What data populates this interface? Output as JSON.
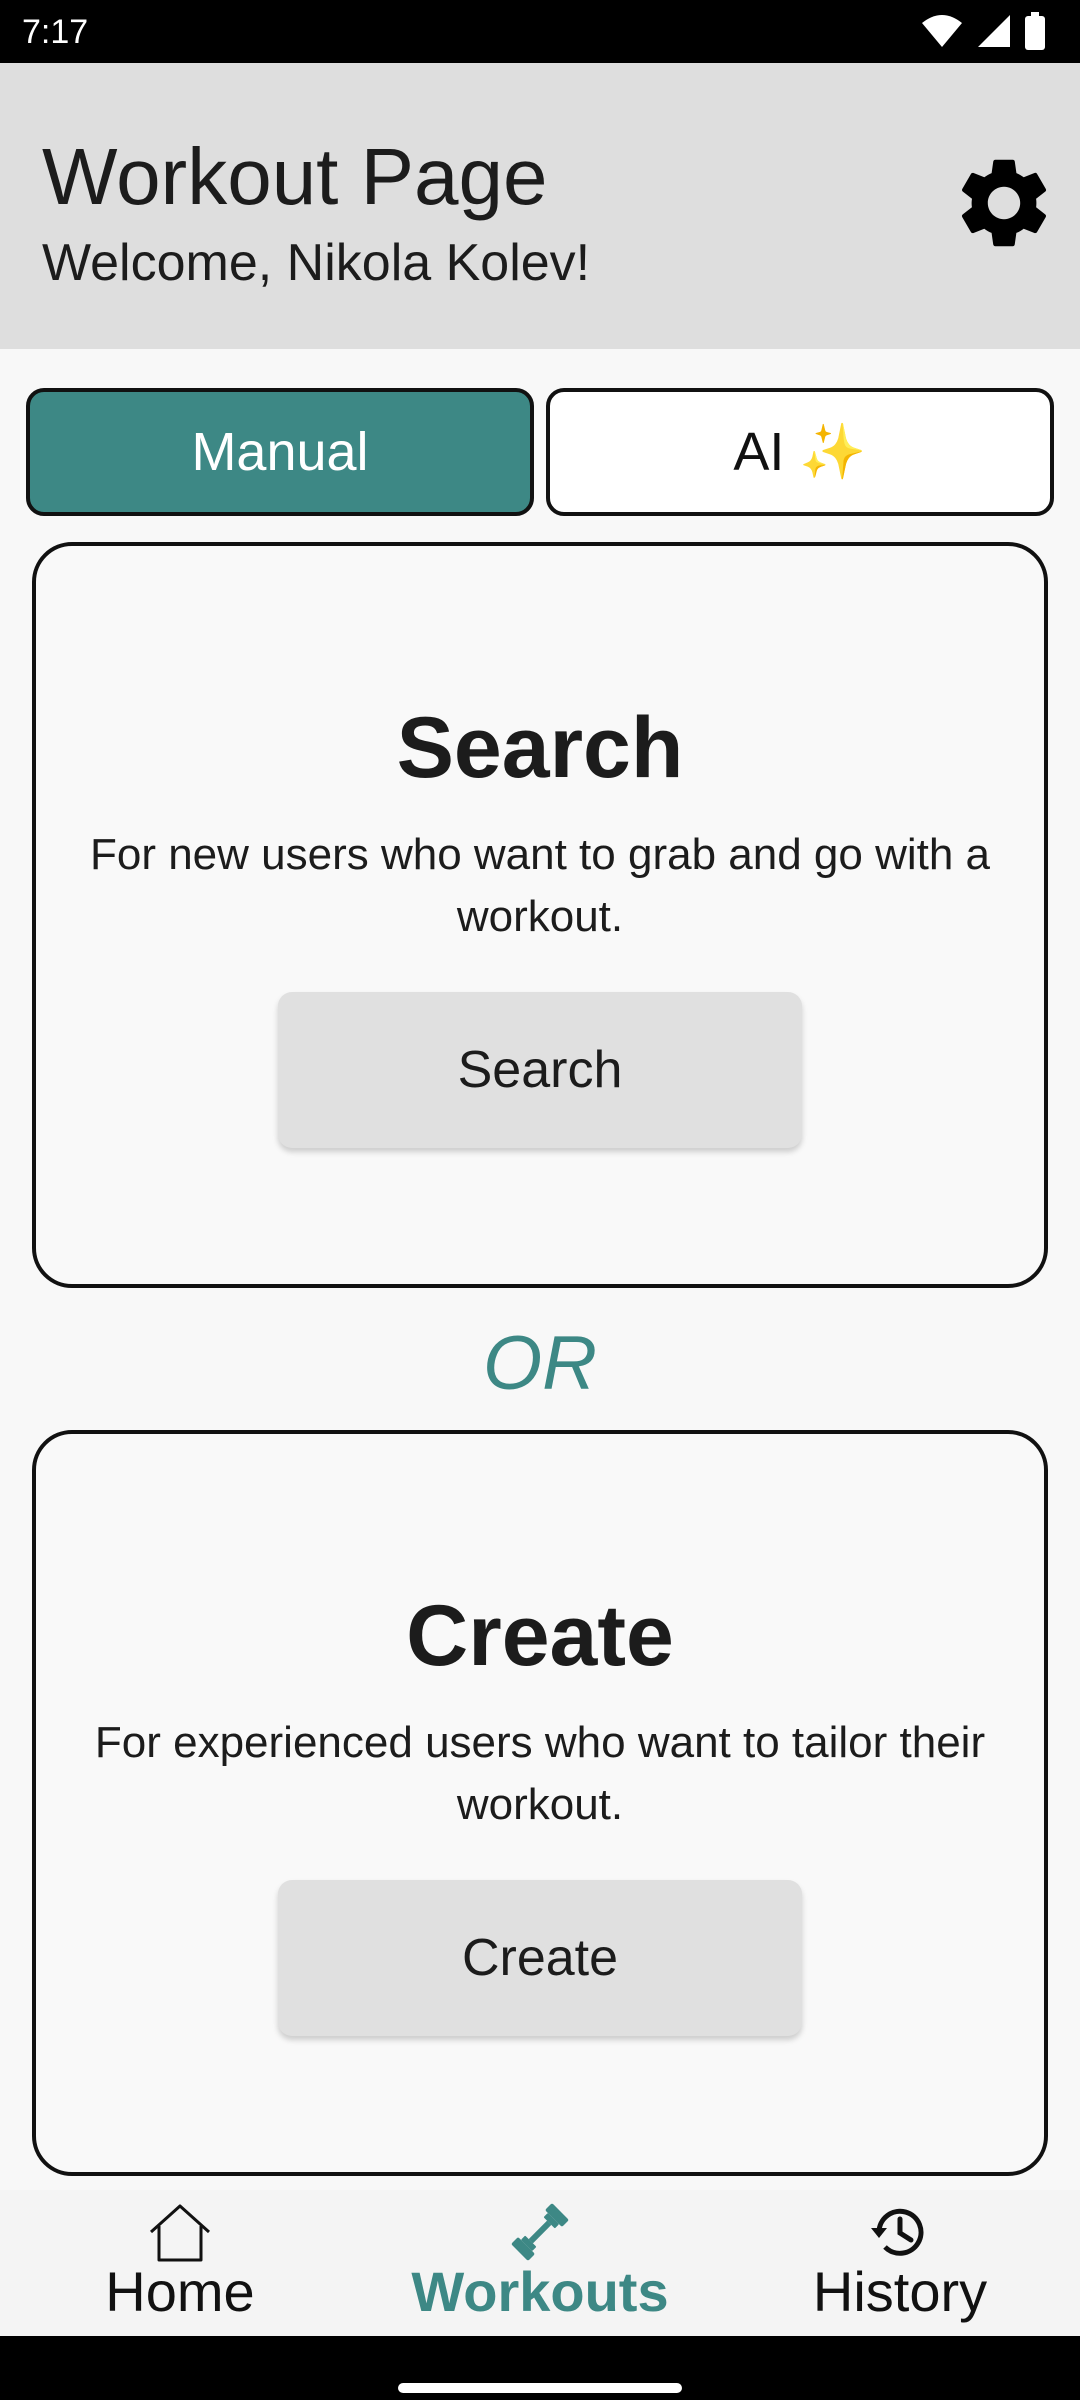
{
  "status_bar": {
    "time": "7:17",
    "icons": [
      "wifi-icon",
      "signal-icon",
      "battery-icon"
    ]
  },
  "header": {
    "title": "Workout Page",
    "welcome": "Welcome, Nikola Kolev!",
    "settings_icon": "gear-icon"
  },
  "tabs": [
    {
      "label": "Manual",
      "active": true
    },
    {
      "label": "AI ✨",
      "active": false
    }
  ],
  "search_card": {
    "title": "Search",
    "description": "For new users who want to grab and go with a workout.",
    "button_label": "Search"
  },
  "or_label": "OR",
  "create_card": {
    "title": "Create",
    "description": "For experienced users who want to tailor their workout.",
    "button_label": "Create"
  },
  "bottom_nav": {
    "items": [
      {
        "label": "Home",
        "icon": "home-icon",
        "active": false
      },
      {
        "label": "Workouts",
        "icon": "dumbbell-icon",
        "active": true
      },
      {
        "label": "History",
        "icon": "history-icon",
        "active": false
      }
    ]
  },
  "colors": {
    "accent": "#3d8885",
    "header_bg": "#dedede",
    "button_bg": "#e0e0e0"
  }
}
